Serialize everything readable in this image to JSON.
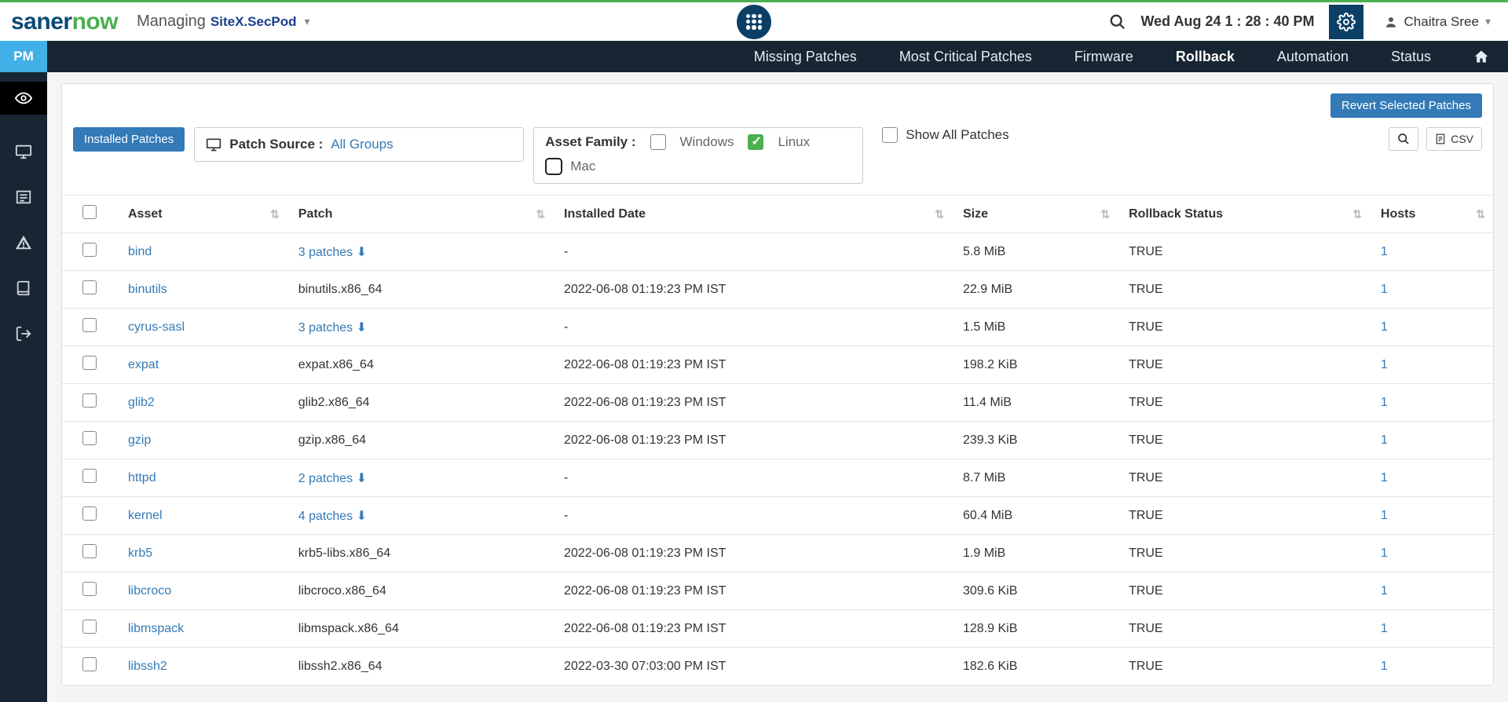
{
  "header": {
    "logo_part1": "saner",
    "logo_part2": "now",
    "managing_label": "Managing",
    "site": "SiteX.SecPod",
    "datetime": "Wed Aug 24  1 : 28 : 40 PM",
    "user": "Chaitra Sree"
  },
  "nav": {
    "pm": "PM",
    "items": [
      "Missing Patches",
      "Most Critical Patches",
      "Firmware",
      "Rollback",
      "Automation",
      "Status"
    ],
    "active": "Rollback"
  },
  "actions": {
    "revert": "Revert Selected Patches",
    "installed_patches": "Installed Patches",
    "patch_source_label": "Patch Source :",
    "patch_source_value": "All Groups",
    "asset_family_label": "Asset Family :",
    "windows": "Windows",
    "linux": "Linux",
    "mac": "Mac",
    "show_all": "Show All Patches",
    "csv": "CSV"
  },
  "columns": [
    "Asset",
    "Patch",
    "Installed Date",
    "Size",
    "Rollback Status",
    "Hosts"
  ],
  "rows": [
    {
      "asset": "bind",
      "patch": "3 patches",
      "patch_link": true,
      "date": "-",
      "size": "5.8 MiB",
      "status": "TRUE",
      "hosts": "1"
    },
    {
      "asset": "binutils",
      "patch": "binutils.x86_64",
      "patch_link": false,
      "date": "2022-06-08 01:19:23 PM IST",
      "size": "22.9 MiB",
      "status": "TRUE",
      "hosts": "1"
    },
    {
      "asset": "cyrus-sasl",
      "patch": "3 patches",
      "patch_link": true,
      "date": "-",
      "size": "1.5 MiB",
      "status": "TRUE",
      "hosts": "1"
    },
    {
      "asset": "expat",
      "patch": "expat.x86_64",
      "patch_link": false,
      "date": "2022-06-08 01:19:23 PM IST",
      "size": "198.2 KiB",
      "status": "TRUE",
      "hosts": "1"
    },
    {
      "asset": "glib2",
      "patch": "glib2.x86_64",
      "patch_link": false,
      "date": "2022-06-08 01:19:23 PM IST",
      "size": "11.4 MiB",
      "status": "TRUE",
      "hosts": "1"
    },
    {
      "asset": "gzip",
      "patch": "gzip.x86_64",
      "patch_link": false,
      "date": "2022-06-08 01:19:23 PM IST",
      "size": "239.3 KiB",
      "status": "TRUE",
      "hosts": "1"
    },
    {
      "asset": "httpd",
      "patch": "2 patches",
      "patch_link": true,
      "date": "-",
      "size": "8.7 MiB",
      "status": "TRUE",
      "hosts": "1"
    },
    {
      "asset": "kernel",
      "patch": "4 patches",
      "patch_link": true,
      "date": "-",
      "size": "60.4 MiB",
      "status": "TRUE",
      "hosts": "1"
    },
    {
      "asset": "krb5",
      "patch": "krb5-libs.x86_64",
      "patch_link": false,
      "date": "2022-06-08 01:19:23 PM IST",
      "size": "1.9 MiB",
      "status": "TRUE",
      "hosts": "1"
    },
    {
      "asset": "libcroco",
      "patch": "libcroco.x86_64",
      "patch_link": false,
      "date": "2022-06-08 01:19:23 PM IST",
      "size": "309.6 KiB",
      "status": "TRUE",
      "hosts": "1"
    },
    {
      "asset": "libmspack",
      "patch": "libmspack.x86_64",
      "patch_link": false,
      "date": "2022-06-08 01:19:23 PM IST",
      "size": "128.9 KiB",
      "status": "TRUE",
      "hosts": "1"
    },
    {
      "asset": "libssh2",
      "patch": "libssh2.x86_64",
      "patch_link": false,
      "date": "2022-03-30 07:03:00 PM IST",
      "size": "182.6 KiB",
      "status": "TRUE",
      "hosts": "1"
    }
  ]
}
